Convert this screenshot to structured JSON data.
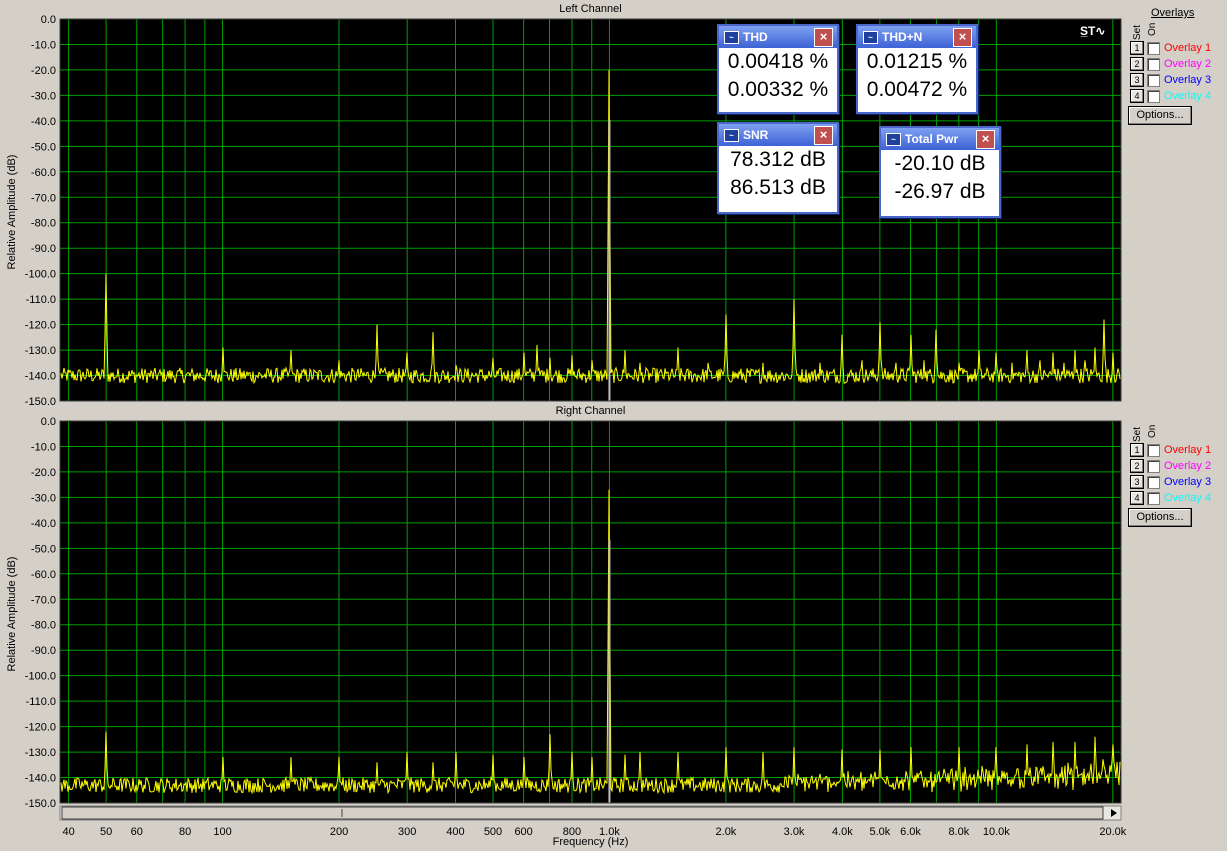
{
  "charts": [
    {
      "title": "Left Channel",
      "ylabel": "Relative Amplitude (dB)"
    },
    {
      "title": "Right Channel",
      "ylabel": "Relative Amplitude (dB)"
    }
  ],
  "xlabel": "Frequency (Hz)",
  "y_ticks": [
    "0.0",
    "-10.0",
    "-20.0",
    "-30.0",
    "-40.0",
    "-50.0",
    "-60.0",
    "-70.0",
    "-80.0",
    "-90.0",
    "-100.0",
    "-110.0",
    "-120.0",
    "-130.0",
    "-140.0",
    "-150.0"
  ],
  "x_ticks": [
    {
      "v": 40,
      "label": "40"
    },
    {
      "v": 50,
      "label": "50"
    },
    {
      "v": 60,
      "label": "60"
    },
    {
      "v": 80,
      "label": "80"
    },
    {
      "v": 100,
      "label": "100"
    },
    {
      "v": 200,
      "label": "200"
    },
    {
      "v": 300,
      "label": "300"
    },
    {
      "v": 400,
      "label": "400"
    },
    {
      "v": 500,
      "label": "500"
    },
    {
      "v": 600,
      "label": "600"
    },
    {
      "v": 800,
      "label": "800"
    },
    {
      "v": 1000,
      "label": "1.0k"
    },
    {
      "v": 2000,
      "label": "2.0k"
    },
    {
      "v": 3000,
      "label": "3.0k"
    },
    {
      "v": 4000,
      "label": "4.0k"
    },
    {
      "v": 5000,
      "label": "5.0k"
    },
    {
      "v": 6000,
      "label": "6.0k"
    },
    {
      "v": 8000,
      "label": "8.0k"
    },
    {
      "v": 10000,
      "label": "10.0k"
    },
    {
      "v": 20000,
      "label": "20.0k"
    }
  ],
  "chart_data": [
    {
      "type": "line",
      "title": "Left Channel",
      "xlabel": "Frequency (Hz)",
      "ylabel": "Relative Amplitude (dB)",
      "xscale": "log",
      "xlim": [
        38,
        21000
      ],
      "ylim": [
        -150,
        0
      ],
      "grid": true,
      "floor": -140,
      "peaks": [
        [
          50,
          -100
        ],
        [
          100,
          -129
        ],
        [
          150,
          -130
        ],
        [
          200,
          -134
        ],
        [
          250,
          -120
        ],
        [
          300,
          -131
        ],
        [
          350,
          -123
        ],
        [
          400,
          -136
        ],
        [
          500,
          -133
        ],
        [
          600,
          -131
        ],
        [
          650,
          -128
        ],
        [
          700,
          -133
        ],
        [
          800,
          -132
        ],
        [
          900,
          -134
        ],
        [
          1000,
          -20
        ],
        [
          1100,
          -130
        ],
        [
          1200,
          -135
        ],
        [
          1500,
          -129
        ],
        [
          1800,
          -135
        ],
        [
          2000,
          -116
        ],
        [
          2500,
          -135
        ],
        [
          3000,
          -110
        ],
        [
          3500,
          -135
        ],
        [
          4000,
          -124
        ],
        [
          4500,
          -134
        ],
        [
          5000,
          -119
        ],
        [
          5500,
          -135
        ],
        [
          6000,
          -124
        ],
        [
          6500,
          -134
        ],
        [
          7000,
          -122
        ],
        [
          8000,
          -135
        ],
        [
          9000,
          -130
        ],
        [
          10000,
          -131
        ],
        [
          11000,
          -135
        ],
        [
          12000,
          -130
        ],
        [
          13000,
          -134
        ],
        [
          14000,
          -131
        ],
        [
          15000,
          -135
        ],
        [
          16000,
          -130
        ],
        [
          17000,
          -134
        ],
        [
          18000,
          -129
        ],
        [
          19000,
          -118
        ],
        [
          20000,
          -131
        ]
      ]
    },
    {
      "type": "line",
      "title": "Right Channel",
      "xlabel": "Frequency (Hz)",
      "ylabel": "Relative Amplitude (dB)",
      "xscale": "log",
      "xlim": [
        38,
        21000
      ],
      "ylim": [
        -150,
        0
      ],
      "grid": true,
      "floor": -143,
      "peaks": [
        [
          50,
          -122
        ],
        [
          100,
          -132
        ],
        [
          150,
          -132
        ],
        [
          200,
          -132
        ],
        [
          250,
          -134
        ],
        [
          300,
          -130
        ],
        [
          350,
          -134
        ],
        [
          400,
          -130
        ],
        [
          500,
          -131
        ],
        [
          600,
          -132
        ],
        [
          700,
          -123
        ],
        [
          800,
          -130
        ],
        [
          900,
          -132
        ],
        [
          1000,
          -27
        ],
        [
          1100,
          -131
        ],
        [
          1200,
          -130
        ],
        [
          1500,
          -130
        ],
        [
          2000,
          -128
        ],
        [
          2500,
          -130
        ],
        [
          3000,
          -128
        ],
        [
          4000,
          -129
        ],
        [
          5000,
          -129
        ],
        [
          6000,
          -128
        ],
        [
          8000,
          -128
        ],
        [
          10000,
          -128
        ],
        [
          12000,
          -127
        ],
        [
          14000,
          -126
        ],
        [
          16000,
          -126
        ],
        [
          18000,
          -124
        ],
        [
          20000,
          -127
        ]
      ]
    }
  ],
  "meters": [
    {
      "name": "THD",
      "v1": "0.00418 %",
      "v2": "0.00332 %"
    },
    {
      "name": "THD+N",
      "v1": "0.01215 %",
      "v2": "0.00472 %"
    },
    {
      "name": "SNR",
      "v1": "78.312 dB",
      "v2": "86.513 dB"
    },
    {
      "name": "Total Pwr",
      "v1": "-20.10 dB",
      "v2": "-26.97 dB"
    }
  ],
  "side": {
    "overlays_header": "Overlays",
    "set": "Set",
    "on": "On",
    "options": "Options...",
    "overlays": [
      {
        "num": "1",
        "label": "Overlay 1",
        "color": "#ff0000"
      },
      {
        "num": "2",
        "label": "Overlay 2",
        "color": "#ff00ff"
      },
      {
        "num": "3",
        "label": "Overlay 3",
        "color": "#0000ff"
      },
      {
        "num": "4",
        "label": "Overlay 4",
        "color": "#00ffff"
      }
    ]
  },
  "colors": {
    "plot_bg": "#000000",
    "grid": "#00a000",
    "trace": "#ffff00",
    "carrier": "#c0c0c0"
  }
}
